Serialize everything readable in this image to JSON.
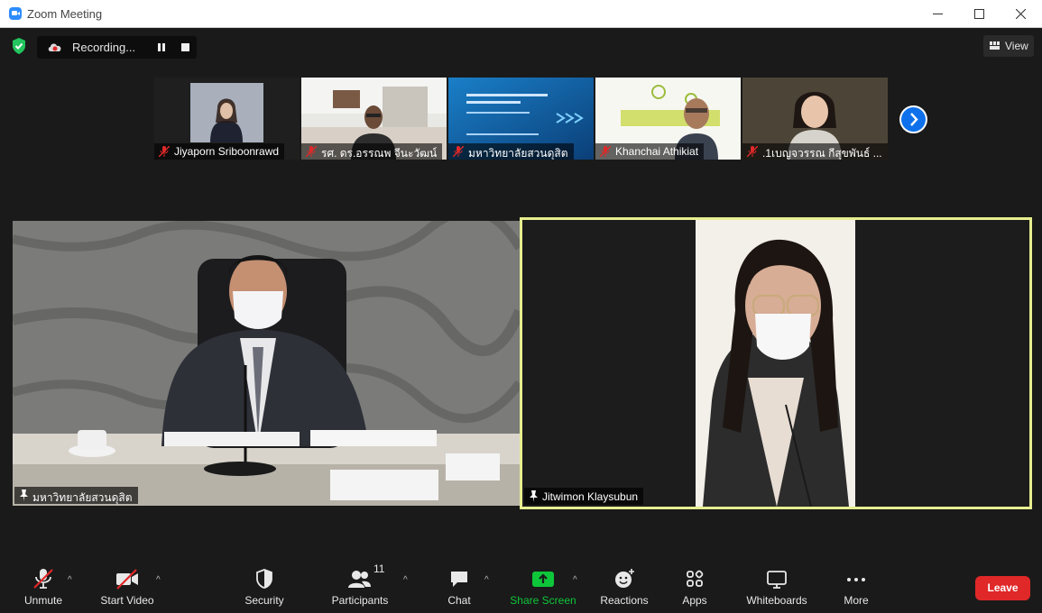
{
  "window": {
    "title": "Zoom Meeting",
    "controls": {
      "minimize": "—",
      "maximize": "☐",
      "close": "✕"
    }
  },
  "top_bar": {
    "recording_label": "Recording...",
    "view_label": "View",
    "icons": [
      "shield-check-icon",
      "cloud-record-icon",
      "pause-icon",
      "stop-icon",
      "grid-view-icon"
    ]
  },
  "thumbnails": [
    {
      "name": "Jiyaporn Sriboonrawd",
      "muted": true
    },
    {
      "name": "รศ. ดร.อรรณพ จีนะวัฒน์",
      "muted": true
    },
    {
      "name": "มหาวิทยาลัยสวนดุสิต",
      "muted": true
    },
    {
      "name": "Khanchai Athikiat",
      "muted": true
    },
    {
      "name": ".1เบญจวรรณ กีสุขพันธ์ ...",
      "muted": true
    }
  ],
  "main_tiles": [
    {
      "name": "มหาวิทยาลัยสวนดุสิต",
      "pinned": true,
      "active_speaker": false
    },
    {
      "name": "Jitwimon Klaysubun",
      "pinned": true,
      "active_speaker": true
    }
  ],
  "toolbar": {
    "unmute": "Unmute",
    "start_video": "Start Video",
    "security": "Security",
    "participants": "Participants",
    "participants_count": "11",
    "chat": "Chat",
    "share_screen": "Share Screen",
    "reactions": "Reactions",
    "apps": "Apps",
    "whiteboards": "Whiteboards",
    "more": "More",
    "leave": "Leave",
    "caret": "^"
  },
  "colors": {
    "accent_blue": "#0e71eb",
    "share_green": "#0ec63a",
    "leave_red": "#e02828",
    "speaker_border": "#e6ee8f",
    "muted_red": "#e02828"
  }
}
